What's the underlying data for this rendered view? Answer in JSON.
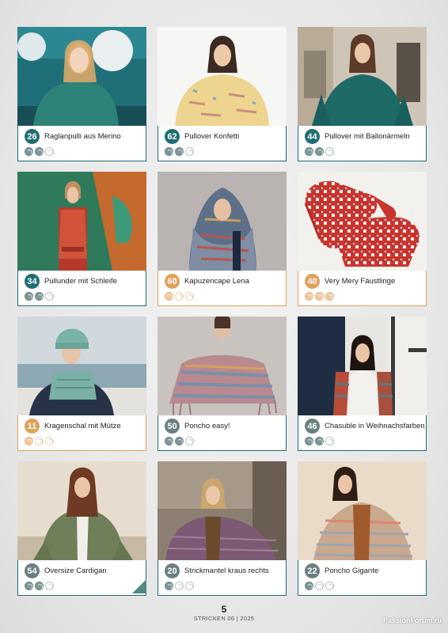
{
  "cards": [
    {
      "num": "26",
      "title": "Raglanpulli aus Merino",
      "level": 2,
      "style": "teal"
    },
    {
      "num": "62",
      "title": "Pullover Konfetti",
      "level": 2,
      "style": "teal"
    },
    {
      "num": "44",
      "title": "Pullover mit Ballonärmeln",
      "level": 2,
      "style": "teal"
    },
    {
      "num": "34",
      "title": "Pullunder mit Schleife",
      "level": 2,
      "style": "teal"
    },
    {
      "num": "60",
      "title": "Kapuzencape Lena",
      "level": 1,
      "style": "orange"
    },
    {
      "num": "40",
      "title": "Very Mery Fäustlinge",
      "level": 3,
      "style": "orange"
    },
    {
      "num": "11",
      "title": "Kragenschal mit Mütze",
      "level": 1,
      "style": "orange"
    },
    {
      "num": "50",
      "title": "Poncho easy!",
      "level": 2,
      "style": "gray"
    },
    {
      "num": "46",
      "title": "Chasuble in Weihnachsfarben",
      "level": 2,
      "style": "gray"
    },
    {
      "num": "54",
      "title": "Oversize Cardigan",
      "level": 2,
      "style": "gray"
    },
    {
      "num": "20",
      "title": "Strickmantel kraus rechts",
      "level": 1,
      "style": "gray"
    },
    {
      "num": "22",
      "title": "Poncho Gigante",
      "level": 1,
      "style": "gray"
    }
  ],
  "footer": {
    "page": "5",
    "issue": "STRICKEN 06 | 2025"
  },
  "watermark": "PassionForum.ru"
}
